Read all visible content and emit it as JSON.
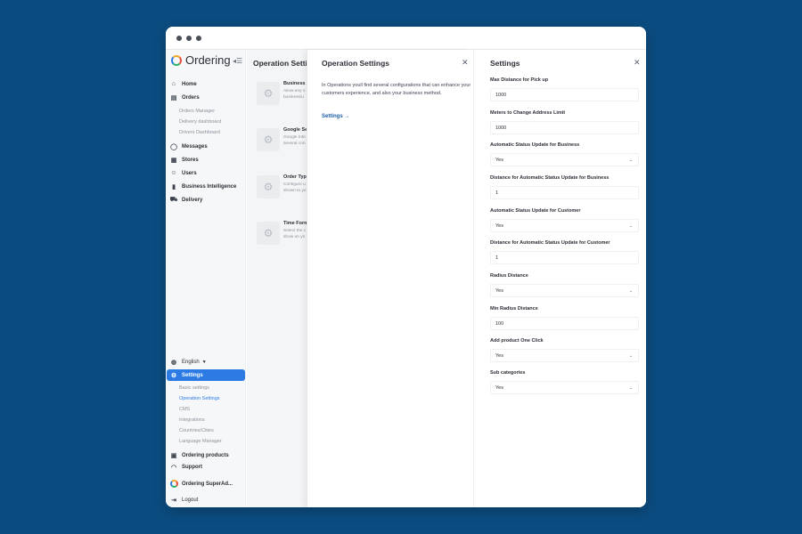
{
  "sidebar": {
    "logo_text": "Ordering",
    "nav": [
      {
        "label": "Home",
        "icon": "home-icon"
      },
      {
        "label": "Orders",
        "icon": "orders-icon"
      },
      {
        "label": "Messages",
        "icon": "message-icon"
      },
      {
        "label": "Stores",
        "icon": "store-icon"
      },
      {
        "label": "Users",
        "icon": "users-icon"
      },
      {
        "label": "Business Intelligence",
        "icon": "chart-icon"
      },
      {
        "label": "Delivery",
        "icon": "truck-icon"
      }
    ],
    "orders_sub": [
      "Orders Manager",
      "Delivery dashboard",
      "Drivers Dashboard"
    ],
    "language": "English",
    "settings_label": "Settings",
    "settings_sub": [
      "Basic settings",
      "Operation Settings",
      "CMS",
      "Integrations",
      "Countries/Cities",
      "Language Manager"
    ],
    "ordering_products": "Ordering products",
    "support": "Support",
    "account_name": "Ordering SuperAd...",
    "logout": "Logout"
  },
  "list_pane": {
    "title": "Operation Settings",
    "cards": [
      {
        "title": "Business S",
        "desc": [
          "Allow any u",
          "business/u"
        ]
      },
      {
        "title": "Google Set",
        "desc": [
          "Google Inte",
          "several con"
        ]
      },
      {
        "title": "Order Type",
        "desc": [
          "Configure u",
          "shown to yo"
        ]
      },
      {
        "title": "Time Form",
        "desc": [
          "Select the c",
          "show on yo"
        ]
      }
    ]
  },
  "operation_panel": {
    "title": "Operation Settings",
    "description": "In Operations youll find several configurations that can enhance your customers experience, and also your business method.",
    "link": "Settings →"
  },
  "settings_panel": {
    "title": "Settings",
    "fields": [
      {
        "label": "Max Distance for Pick up",
        "value": "1000",
        "type": "input"
      },
      {
        "label": "Meters to Change Address Limit",
        "value": "1000",
        "type": "input"
      },
      {
        "label": "Automatic Status Update for Business",
        "value": "Yes",
        "type": "select"
      },
      {
        "label": "Distance for Automatic Status Update for Business",
        "value": "1",
        "type": "input"
      },
      {
        "label": "Automatic Status Update for Customer",
        "value": "Yes",
        "type": "select"
      },
      {
        "label": "Distance for Automatic Status Update for Customer",
        "value": "1",
        "type": "input"
      },
      {
        "label": "Radius Distance",
        "value": "Yes",
        "type": "select"
      },
      {
        "label": "Min Radius Distance",
        "value": "100",
        "type": "input"
      },
      {
        "label": "Add product One Click",
        "value": "Yes",
        "type": "select"
      },
      {
        "label": "Sub categories",
        "value": "Yes",
        "type": "select"
      }
    ]
  },
  "colors": {
    "accent": "#2c7be5",
    "background": "#0b4c80"
  }
}
